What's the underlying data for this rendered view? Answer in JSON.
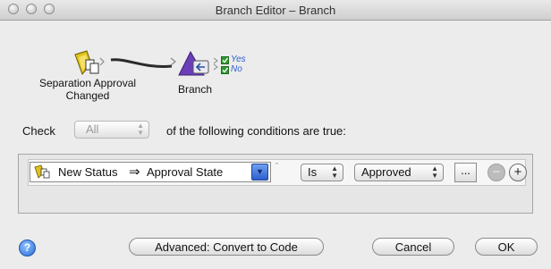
{
  "window": {
    "title": "Branch Editor – Branch"
  },
  "flow": {
    "source_label_line1": "Separation Approval",
    "source_label_line2": "Changed",
    "target_label": "Branch",
    "yes_label": "Yes",
    "no_label": "No"
  },
  "condition_header": {
    "check_label": "Check",
    "match_value": "All",
    "suffix": "of the following conditions are true:"
  },
  "condition_row": {
    "field": "New Status",
    "subfield": "Approval State",
    "operator": "Is",
    "value": "Approved",
    "more_button": "..."
  },
  "footer": {
    "help_button": "?",
    "convert_button": "Advanced: Convert to Code",
    "cancel_button": "Cancel",
    "ok_button": "OK"
  },
  "colors": {
    "accent_blue": "#2c5fcf",
    "check_green": "#2f9a2f",
    "help_blue": "#3a7fe0"
  }
}
